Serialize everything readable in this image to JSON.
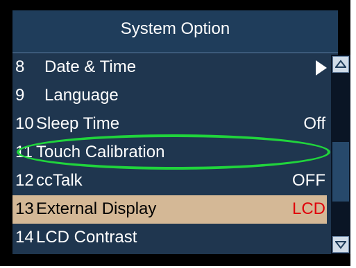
{
  "title": "System Option",
  "menu": {
    "items": [
      {
        "num": "8",
        "label": "Date & Time",
        "value": "",
        "has_submenu": true,
        "selected": false
      },
      {
        "num": "9",
        "label": "Language",
        "value": "",
        "has_submenu": false,
        "selected": false
      },
      {
        "num": "10",
        "label": "Sleep Time",
        "value": "Off",
        "has_submenu": false,
        "selected": false
      },
      {
        "num": "11",
        "label": "Touch Calibration",
        "value": "",
        "has_submenu": false,
        "selected": false
      },
      {
        "num": "12",
        "label": "ccTalk",
        "value": "OFF",
        "has_submenu": false,
        "selected": false
      },
      {
        "num": "13",
        "label": "External Display",
        "value": "LCD",
        "has_submenu": false,
        "selected": true
      },
      {
        "num": "14",
        "label": "LCD Contrast",
        "value": "",
        "has_submenu": false,
        "selected": false
      }
    ]
  },
  "icons": {
    "submenu": "chevron-right-icon",
    "scroll_up": "scroll-up-icon",
    "scroll_down": "scroll-down-icon"
  },
  "colors": {
    "background": "#1f364f",
    "selected_row": "#d4b896",
    "selected_value": "#e0000a",
    "highlight_ring": "#20d43c"
  }
}
